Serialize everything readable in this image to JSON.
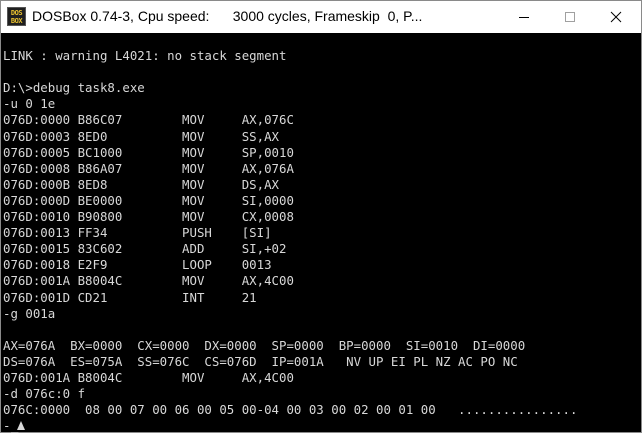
{
  "window": {
    "title": "DOSBox 0.74-3, Cpu speed:      3000 cycles, Frameskip  0, P...",
    "icon_text_top": "DOS",
    "icon_text_bottom": "BOX",
    "icons": {
      "app": "dosbox-app-icon",
      "minimize": "minimize-icon",
      "maximize": "maximize-icon",
      "close": "close-icon",
      "pointer": "mouse-pointer-icon"
    }
  },
  "console": {
    "lines": [
      "LINK : warning L4021: no stack segment",
      "",
      "D:\\>debug task8.exe",
      "-u 0 1e",
      "076D:0000 B86C07        MOV     AX,076C",
      "076D:0003 8ED0          MOV     SS,AX",
      "076D:0005 BC1000        MOV     SP,0010",
      "076D:0008 B86A07        MOV     AX,076A",
      "076D:000B 8ED8          MOV     DS,AX",
      "076D:000D BE0000        MOV     SI,0000",
      "076D:0010 B90800        MOV     CX,0008",
      "076D:0013 FF34          PUSH    [SI]",
      "076D:0015 83C602        ADD     SI,+02",
      "076D:0018 E2F9          LOOP    0013",
      "076D:001A B8004C        MOV     AX,4C00",
      "076D:001D CD21          INT     21",
      "-g 001a",
      "",
      "AX=076A  BX=0000  CX=0000  DX=0000  SP=0000  BP=0000  SI=0010  DI=0000",
      "DS=076A  ES=075A  SS=076C  CS=076D  IP=001A   NV UP EI PL NZ AC PO NC",
      "076D:001A B8004C        MOV     AX,4C00",
      "-d 076c:0 f",
      "076C:0000  08 00 07 00 06 00 05 00-04 00 03 00 02 00 01 00   ................",
      "-"
    ],
    "cursor": "_"
  },
  "colors": {
    "console_bg": "#000000",
    "console_fg": "#d8d8d8",
    "titlebar_bg": "#ffffff"
  }
}
